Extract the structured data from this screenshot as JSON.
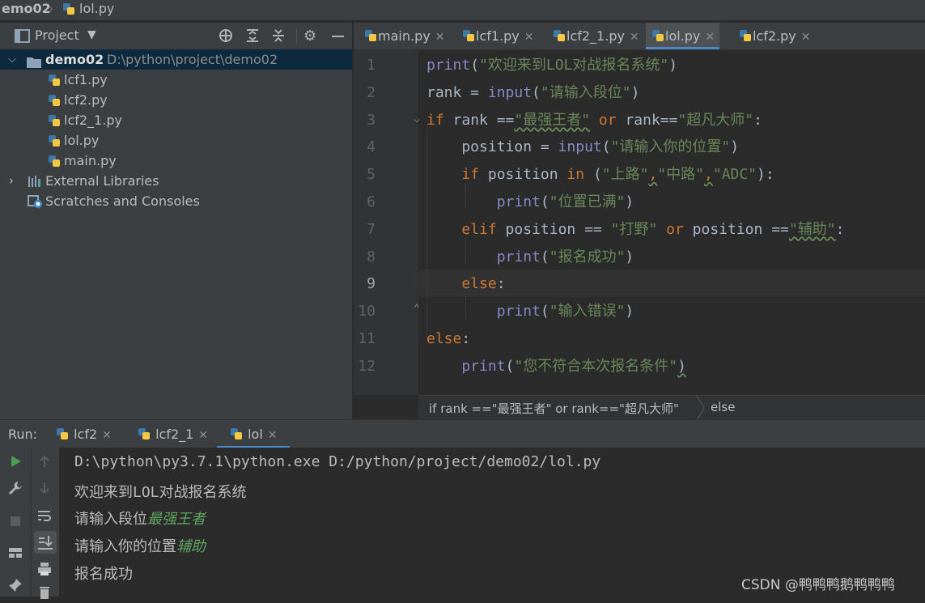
{
  "breadcrumb": {
    "project": "emo02",
    "file": "lol.py"
  },
  "project_panel": {
    "title": "Project",
    "root": {
      "name": "demo02",
      "path": "D:\\python\\project\\demo02"
    },
    "files": [
      "lcf1.py",
      "lcf2.py",
      "lcf2_1.py",
      "lol.py",
      "main.py"
    ],
    "external": "External Libraries",
    "scratches": "Scratches and Consoles"
  },
  "editor_tabs": [
    {
      "label": "main.py",
      "active": false
    },
    {
      "label": "lcf1.py",
      "active": false
    },
    {
      "label": "lcf2_1.py",
      "active": false
    },
    {
      "label": "lol.py",
      "active": true
    },
    {
      "label": "lcf2.py",
      "active": false
    }
  ],
  "code": {
    "line_numbers": [
      "1",
      "2",
      "3",
      "4",
      "5",
      "6",
      "7",
      "8",
      "9",
      "10",
      "11",
      "12"
    ],
    "current_line": "9",
    "lines": [
      [
        {
          "t": "print",
          "c": "fn"
        },
        {
          "t": "(",
          "c": ""
        },
        {
          "t": "\"欢迎来到LOL对战报名系统\"",
          "c": "str"
        },
        {
          "t": ")",
          "c": ""
        }
      ],
      [
        {
          "t": "rank = ",
          "c": ""
        },
        {
          "t": "input",
          "c": "fn"
        },
        {
          "t": "(",
          "c": ""
        },
        {
          "t": "\"请输入段位\"",
          "c": "str"
        },
        {
          "t": ")",
          "c": ""
        }
      ],
      [
        {
          "t": "if",
          "c": "kw"
        },
        {
          "t": " rank ==",
          "c": ""
        },
        {
          "t": "\"最强王者\"",
          "c": "str wavy"
        },
        {
          "t": " ",
          "c": ""
        },
        {
          "t": "or",
          "c": "kw"
        },
        {
          "t": " rank==",
          "c": ""
        },
        {
          "t": "\"超凡大师\"",
          "c": "str"
        },
        {
          "t": ":",
          "c": ""
        }
      ],
      [
        {
          "t": "    position = ",
          "c": ""
        },
        {
          "t": "input",
          "c": "fn"
        },
        {
          "t": "(",
          "c": ""
        },
        {
          "t": "\"请输入你的位置\"",
          "c": "str"
        },
        {
          "t": ")",
          "c": ""
        }
      ],
      [
        {
          "t": "    ",
          "c": ""
        },
        {
          "t": "if",
          "c": "kw"
        },
        {
          "t": " position ",
          "c": ""
        },
        {
          "t": "in",
          "c": "kw"
        },
        {
          "t": " (",
          "c": ""
        },
        {
          "t": "\"上路\"",
          "c": "str"
        },
        {
          "t": ",",
          "c": "kw wavy"
        },
        {
          "t": "\"中路\"",
          "c": "str"
        },
        {
          "t": ",",
          "c": "kw wavy"
        },
        {
          "t": "\"ADC\"",
          "c": "str"
        },
        {
          "t": "):",
          "c": ""
        }
      ],
      [
        {
          "t": "        ",
          "c": ""
        },
        {
          "t": "print",
          "c": "fn"
        },
        {
          "t": "(",
          "c": ""
        },
        {
          "t": "\"位置已满\"",
          "c": "str"
        },
        {
          "t": ")",
          "c": ""
        }
      ],
      [
        {
          "t": "    ",
          "c": ""
        },
        {
          "t": "elif",
          "c": "kw"
        },
        {
          "t": " position == ",
          "c": ""
        },
        {
          "t": "\"打野\"",
          "c": "str"
        },
        {
          "t": " ",
          "c": ""
        },
        {
          "t": "or",
          "c": "kw"
        },
        {
          "t": " position ==",
          "c": ""
        },
        {
          "t": "\"辅助\"",
          "c": "str wavy"
        },
        {
          "t": ":",
          "c": ""
        }
      ],
      [
        {
          "t": "        ",
          "c": ""
        },
        {
          "t": "print",
          "c": "fn"
        },
        {
          "t": "(",
          "c": ""
        },
        {
          "t": "\"报名成功\"",
          "c": "str"
        },
        {
          "t": ")",
          "c": ""
        }
      ],
      [
        {
          "t": "    ",
          "c": ""
        },
        {
          "t": "else",
          "c": "kw"
        },
        {
          "t": ":",
          "c": ""
        }
      ],
      [
        {
          "t": "        ",
          "c": ""
        },
        {
          "t": "print",
          "c": "fn"
        },
        {
          "t": "(",
          "c": ""
        },
        {
          "t": "\"输入错误\"",
          "c": "str"
        },
        {
          "t": ")",
          "c": ""
        }
      ],
      [
        {
          "t": "else",
          "c": "kw"
        },
        {
          "t": ":",
          "c": ""
        }
      ],
      [
        {
          "t": "    ",
          "c": ""
        },
        {
          "t": "print",
          "c": "fn"
        },
        {
          "t": "(",
          "c": ""
        },
        {
          "t": "\"您不符合本次报名条件\"",
          "c": "str"
        },
        {
          "t": ")",
          "c": "wavy"
        }
      ]
    ]
  },
  "editor_breadcrumb": {
    "item1": "if rank ==\"最强王者\" or rank==\"超凡大师\"",
    "item2": "else"
  },
  "run": {
    "label": "Run:",
    "tabs": [
      {
        "label": "lcf2",
        "active": false
      },
      {
        "label": "lcf2_1",
        "active": false
      },
      {
        "label": "lol",
        "active": true
      }
    ]
  },
  "console": {
    "command": "D:\\python\\py3.7.1\\python.exe D:/python/project/demo02/lol.py",
    "line2": "欢迎来到LOL对战报名系统",
    "prompt1": "请输入段位",
    "input1": "最强王者",
    "prompt2": "请输入你的位置",
    "input2": "辅助",
    "line5": "报名成功"
  },
  "watermark": "CSDN @鸭鸭鸭鹅鸭鸭鸭",
  "colors": {
    "keyword": "#cc7832",
    "builtin": "#8888c6",
    "string": "#6a8759",
    "accent": "#4a88c7",
    "console_input": "#5ea65e"
  }
}
